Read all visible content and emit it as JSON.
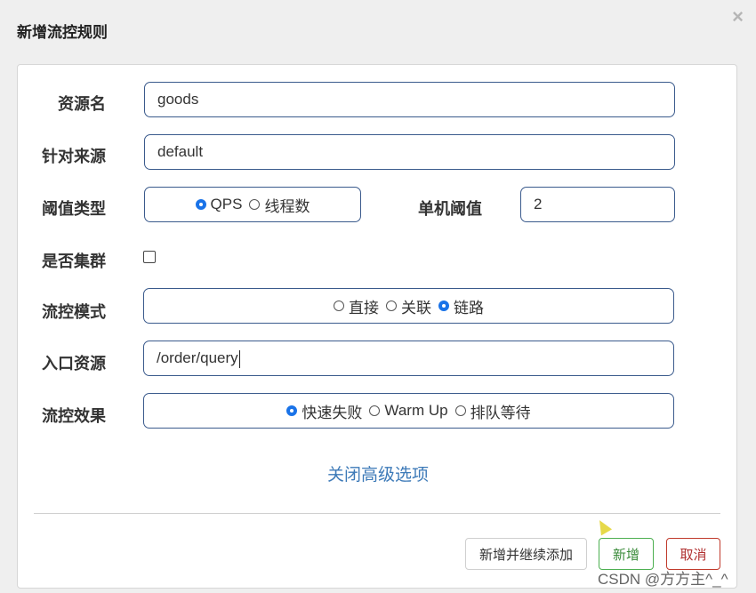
{
  "dialog": {
    "title": "新增流控规则",
    "close_icon": "close-icon"
  },
  "form": {
    "resource_label": "资源名",
    "resource_value": "goods",
    "source_label": "针对来源",
    "source_value": "default",
    "threshold_type_label": "阈值类型",
    "threshold_type_options": [
      "QPS",
      "线程数"
    ],
    "threshold_type_selected": "QPS",
    "single_threshold_label": "单机阈值",
    "single_threshold_value": "2",
    "cluster_label": "是否集群",
    "cluster_checked": false,
    "flow_mode_label": "流控模式",
    "flow_mode_options": [
      "直接",
      "关联",
      "链路"
    ],
    "flow_mode_selected": "链路",
    "entry_resource_label": "入口资源",
    "entry_resource_value": "/order/query",
    "effect_label": "流控效果",
    "effect_options": [
      "快速失败",
      "Warm Up",
      "排队等待"
    ],
    "effect_selected": "快速失败"
  },
  "advanced_link": "关闭高级选项",
  "buttons": {
    "add_continue": "新增并继续添加",
    "add": "新增",
    "cancel": "取消"
  },
  "watermark": "CSDN @方方主^_^",
  "colors": {
    "accent_blue": "#3d7ab8",
    "radio_blue": "#1a73e8",
    "success_green": "#4caf50",
    "danger_red": "#c0392b",
    "input_border": "#3a5a8c"
  }
}
